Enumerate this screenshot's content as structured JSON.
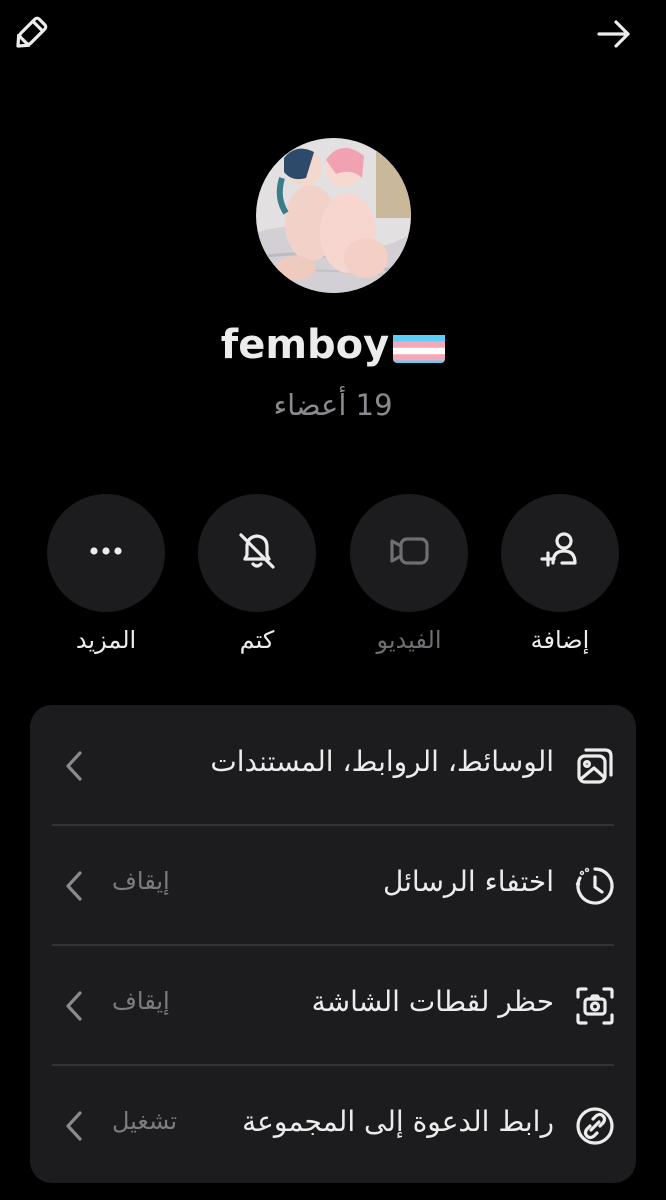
{
  "group": {
    "name": "femboy",
    "members_count": "19",
    "members_label": "أعضاء"
  },
  "actions": [
    {
      "id": "add",
      "label": "إضافة",
      "icon": "add-user-icon",
      "enabled": true
    },
    {
      "id": "video",
      "label": "الفيديو",
      "icon": "video-icon",
      "enabled": false
    },
    {
      "id": "mute",
      "label": "كتم",
      "icon": "bell-off-icon",
      "enabled": true
    },
    {
      "id": "more",
      "label": "المزيد",
      "icon": "more-dots-icon",
      "enabled": true
    }
  ],
  "settings": [
    {
      "title": "الوسائط، الروابط، المستندات",
      "value": "",
      "icon": "media-icon"
    },
    {
      "title": "اختفاء الرسائل",
      "value": "إيقاف",
      "icon": "disappearing-timer-icon"
    },
    {
      "title": "حظر لقطات الشاشة",
      "value": "إيقاف",
      "icon": "screenshot-block-icon"
    },
    {
      "title": "رابط الدعوة إلى المجموعة",
      "value": "تشغيل",
      "icon": "link-icon"
    }
  ],
  "colors": {
    "background": "#000000",
    "card": "#1c1c1e",
    "text": "#ececec",
    "muted": "#8a8a8e",
    "trans_blue": "#5bcefa",
    "trans_pink": "#f5a9b8",
    "trans_white": "#ffffff"
  }
}
